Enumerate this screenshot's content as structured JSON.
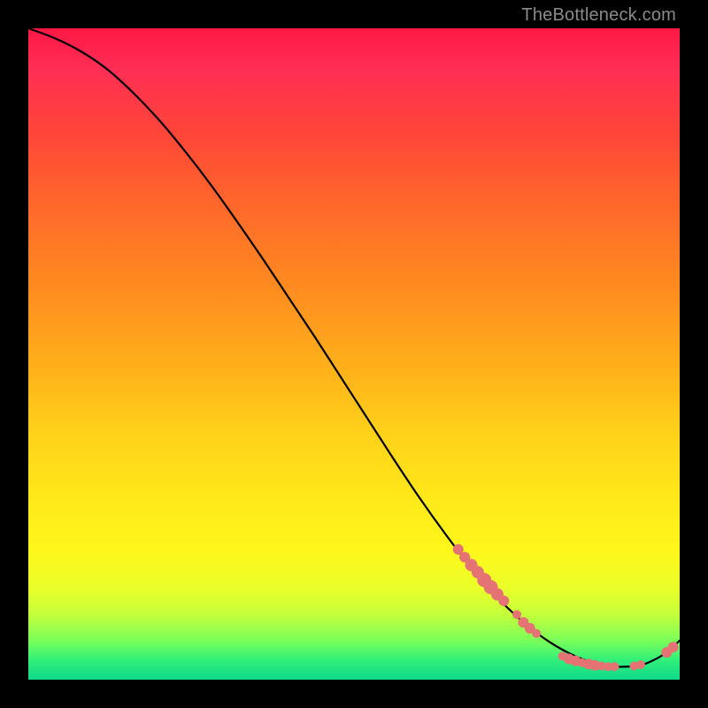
{
  "watermark": "TheBottleneck.com",
  "colors": {
    "background": "#000000",
    "curve": "#000000",
    "dot": "#e57373",
    "gradient_top": "#ff1744",
    "gradient_bottom": "#10d88a"
  },
  "chart_data": {
    "type": "line",
    "title": "",
    "xlabel": "",
    "ylabel": "",
    "xlim": [
      0,
      100
    ],
    "ylim": [
      0,
      100
    ],
    "grid": false,
    "legend": false,
    "series": [
      {
        "name": "bottleneck-curve",
        "x": [
          0,
          4,
          8,
          12,
          16,
          20,
          24,
          28,
          32,
          36,
          40,
          44,
          48,
          52,
          56,
          60,
          64,
          68,
          72,
          76,
          78,
          80,
          82,
          84,
          86,
          88,
          90,
          92,
          94,
          96,
          98,
          100
        ],
        "y": [
          100,
          98.5,
          96.5,
          93.8,
          90.2,
          86.0,
          81.2,
          76.0,
          70.4,
          64.6,
          58.6,
          52.6,
          46.4,
          40.2,
          34.0,
          28.0,
          22.4,
          17.2,
          12.6,
          8.8,
          7.2,
          5.8,
          4.6,
          3.6,
          2.8,
          2.2,
          2.0,
          2.0,
          2.2,
          3.0,
          4.2,
          6.0
        ]
      }
    ],
    "scatter": [
      {
        "name": "highlight-dots",
        "points": [
          {
            "x": 66,
            "y": 20.0,
            "r": 6
          },
          {
            "x": 67,
            "y": 18.8,
            "r": 6
          },
          {
            "x": 68,
            "y": 17.6,
            "r": 7
          },
          {
            "x": 69,
            "y": 16.5,
            "r": 7
          },
          {
            "x": 70,
            "y": 15.3,
            "r": 8
          },
          {
            "x": 71,
            "y": 14.2,
            "r": 8
          },
          {
            "x": 72,
            "y": 13.1,
            "r": 7
          },
          {
            "x": 73,
            "y": 12.1,
            "r": 6
          },
          {
            "x": 75,
            "y": 10.0,
            "r": 5
          },
          {
            "x": 76,
            "y": 8.8,
            "r": 6
          },
          {
            "x": 77,
            "y": 7.9,
            "r": 6
          },
          {
            "x": 78,
            "y": 7.1,
            "r": 5
          },
          {
            "x": 82,
            "y": 3.6,
            "r": 5
          },
          {
            "x": 83,
            "y": 3.2,
            "r": 6
          },
          {
            "x": 84,
            "y": 2.9,
            "r": 6
          },
          {
            "x": 85,
            "y": 2.6,
            "r": 5
          },
          {
            "x": 86,
            "y": 2.4,
            "r": 6
          },
          {
            "x": 87,
            "y": 2.2,
            "r": 6
          },
          {
            "x": 88,
            "y": 2.1,
            "r": 5
          },
          {
            "x": 89,
            "y": 2.0,
            "r": 5
          },
          {
            "x": 90,
            "y": 2.0,
            "r": 5
          },
          {
            "x": 93,
            "y": 2.1,
            "r": 5
          },
          {
            "x": 94,
            "y": 2.3,
            "r": 5
          },
          {
            "x": 98,
            "y": 4.2,
            "r": 6
          },
          {
            "x": 99,
            "y": 5.0,
            "r": 6
          }
        ]
      }
    ]
  }
}
